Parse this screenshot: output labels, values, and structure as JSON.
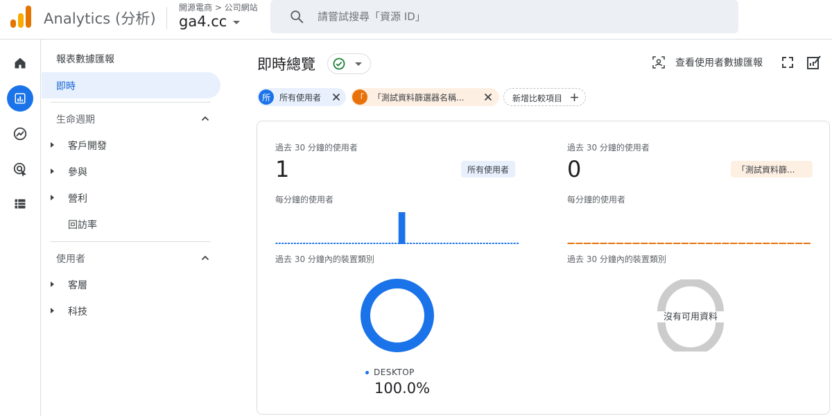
{
  "header": {
    "app_title": "Analytics (分析)",
    "breadcrumb": "開源電商 > 公司網站",
    "property": "ga4.cc",
    "search_placeholder": "請嘗試搜尋「資源 ID」",
    "icons": [
      "analytics-logo",
      "search-icon"
    ]
  },
  "rail": {
    "items": [
      {
        "icon": "home-icon"
      },
      {
        "icon": "reports-icon",
        "active": true
      },
      {
        "icon": "explore-icon"
      },
      {
        "icon": "advertising-icon"
      },
      {
        "icon": "list-icon"
      }
    ]
  },
  "sidenav": {
    "heading": "報表數據匯報",
    "active_item": "即時",
    "sections": [
      {
        "label": "生命週期",
        "items": [
          "客戶開發",
          "參與",
          "營利",
          "回訪率"
        ]
      },
      {
        "label": "使用者",
        "items": [
          "客層",
          "科技"
        ]
      }
    ]
  },
  "main": {
    "title": "即時總覽",
    "view_user_report": "查看使用者數據匯報",
    "chips": [
      {
        "badge": "所",
        "label": "所有使用者",
        "color": "#1a73e8"
      },
      {
        "badge": "「",
        "label": "「測試資料篩選器名稱...",
        "color": "#e8710a"
      }
    ],
    "add_comparison": "新增比較項目",
    "accent_color": "#1a73e8",
    "secondary_color": "#e8710a"
  },
  "cards": [
    {
      "users_label": "過去 30 分鐘的使用者",
      "users_value": "1",
      "badge": "所有使用者",
      "per_minute_label": "每分鐘的使用者",
      "device_label": "過去 30 分鐘內的裝置類別",
      "legend_label": "DESKTOP",
      "legend_value": "100.0%"
    },
    {
      "users_label": "過去 30 分鐘的使用者",
      "users_value": "0",
      "badge": "「測試資料篩...",
      "per_minute_label": "每分鐘的使用者",
      "device_label": "過去 30 分鐘內的裝置類別",
      "empty_text": "沒有可用資料"
    }
  ],
  "chart_data": [
    {
      "type": "bar",
      "series": [
        {
          "values": [
            0,
            0,
            0,
            0,
            0,
            0,
            0,
            0,
            0,
            0,
            0,
            0,
            0,
            0,
            0,
            0,
            0,
            0,
            0,
            0,
            0,
            0,
            0,
            0,
            0,
            0,
            0,
            0,
            0,
            0,
            0,
            0,
            0,
            0,
            0,
            0,
            0,
            0,
            0,
            0,
            0,
            1,
            0,
            0,
            0,
            0,
            0,
            0,
            0,
            0,
            0,
            0,
            0,
            0,
            0,
            0,
            0,
            0,
            0,
            0,
            0,
            0,
            0,
            0,
            0,
            0,
            0,
            0,
            0,
            0,
            0,
            0,
            0,
            0,
            0,
            0,
            0,
            0,
            0,
            0
          ]
        }
      ],
      "color": "#1a73e8"
    },
    {
      "type": "bar",
      "series": [
        {
          "values": [
            0,
            0,
            0,
            0,
            0,
            0,
            0,
            0,
            0,
            0,
            0,
            0,
            0,
            0,
            0,
            0,
            0,
            0,
            0,
            0,
            0,
            0,
            0,
            0,
            0,
            0,
            0,
            0,
            0,
            0
          ]
        }
      ],
      "color": "#e8710a"
    },
    {
      "type": "pie",
      "categories": [
        "DESKTOP"
      ],
      "values": [
        100.0
      ],
      "color": "#1a73e8"
    }
  ]
}
